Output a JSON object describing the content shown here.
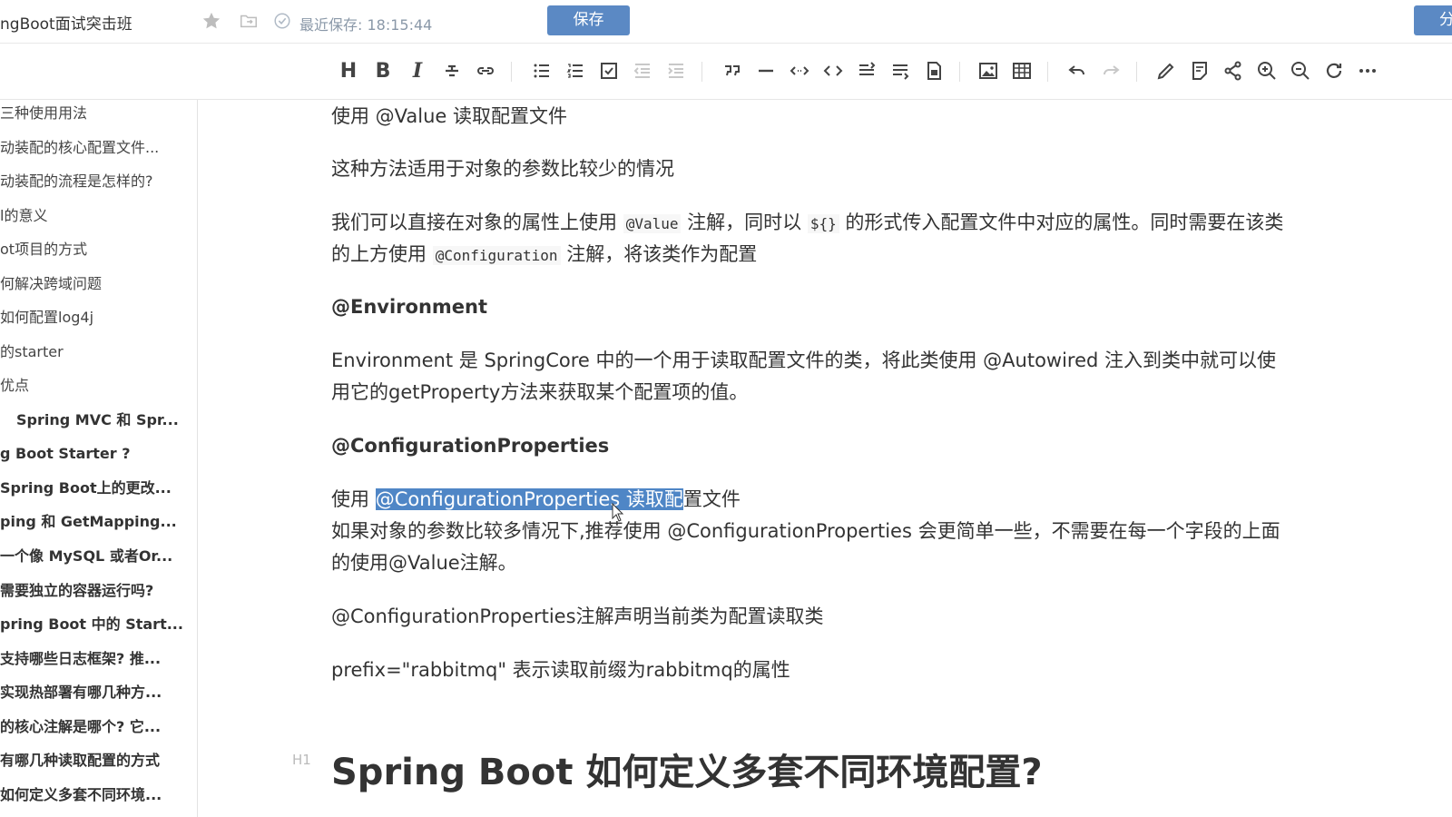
{
  "header": {
    "doc_title": "ngBoot面试突击班",
    "last_saved": "最近保存: 18:15:44",
    "save_label": "保存",
    "share_label": "分",
    "icons": [
      "star-icon",
      "folder-move-icon",
      "check-circle-icon"
    ]
  },
  "toolbar": {
    "heading_label": "H",
    "bold_label": "B",
    "italic_label": "I"
  },
  "sidebar": {
    "items": [
      {
        "label": "三种使用用法",
        "bold": false
      },
      {
        "label": "动装配的核心配置文件...",
        "bold": false
      },
      {
        "label": "动装配的流程是怎样的?",
        "bold": false
      },
      {
        "label": "l的意义",
        "bold": false
      },
      {
        "label": "ot项目的方式",
        "bold": false
      },
      {
        "label": "何解决跨域问题",
        "bold": false
      },
      {
        "label": "如何配置log4j",
        "bold": false
      },
      {
        "label": "的starter",
        "bold": false
      },
      {
        "label": "优点",
        "bold": false
      },
      {
        "label": "  Spring MVC 和 Spr...",
        "bold": true
      },
      {
        "label": "g Boot Starter ?",
        "bold": true
      },
      {
        "label": "Spring Boot上的更改...",
        "bold": true
      },
      {
        "label": "ping 和 GetMapping...",
        "bold": true
      },
      {
        "label": "一个像 MySQL 或者Or...",
        "bold": true
      },
      {
        "label": "需要独立的容器运行吗?",
        "bold": true
      },
      {
        "label": "pring Boot 中的 Start...",
        "bold": true
      },
      {
        "label": "支持哪些日志框架? 推...",
        "bold": true
      },
      {
        "label": "实现热部署有哪几种方...",
        "bold": true
      },
      {
        "label": "的核心注解是哪个? 它...",
        "bold": true
      },
      {
        "label": "有哪几种读取配置的方式",
        "bold": true
      },
      {
        "label": "如何定义多套不同环境...",
        "bold": true
      }
    ]
  },
  "content": {
    "p1": "使用 @Value 读取配置文件",
    "p2": "这种方法适用于对象的参数比较少的情况",
    "p3_a": "我们可以直接在对象的属性上使用 ",
    "p3_code1": "@Value",
    "p3_b": " 注解，同时以 ",
    "p3_code2": "${}",
    "p3_c": " 的形式传入配置文件中对应的属性。同时需要在该类",
    "p3_d": "的上方使用 ",
    "p3_code3": "@Configuration",
    "p3_e": " 注解，将该类作为配置",
    "h_env": "@Environment",
    "p4_line1": "Environment 是 SpringCore 中的一个用于读取配置文件的类，将此类使用 @Autowired 注入到类中就可以使",
    "p4_line2": "用它的getProperty方法来获取某个配置项的值。",
    "h_cp": "@ConfigurationProperties",
    "p5_a": "使用 ",
    "p5_sel": "@ConfigurationProperties 读取配",
    "p5_b": "置文件",
    "p6_line1": "如果对象的参数比较多情况下,推荐使用 @ConfigurationProperties 会更简单一些，不需要在每一个字段的上面",
    "p6_line2": "的使用@Value注解。",
    "p7": "@ConfigurationProperties注解声明当前类为配置读取类",
    "p8": "prefix=\"rabbitmq\" 表示读取前缀为rabbitmq的属性",
    "h1_label": "H1",
    "h1": "Spring Boot 如何定义多套不同环境配置?"
  }
}
